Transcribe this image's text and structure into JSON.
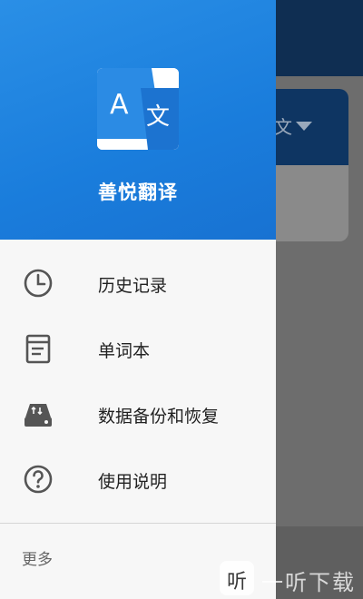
{
  "app": {
    "title": "善悦翻译",
    "logo_icon": "translate-icon",
    "header_color": "#1a7ddc"
  },
  "background": {
    "language_fragment": "文"
  },
  "menu": {
    "items": [
      {
        "label": "历史记录",
        "icon": "clock-icon"
      },
      {
        "label": "单词本",
        "icon": "notebook-icon"
      },
      {
        "label": "数据备份和恢复",
        "icon": "storage-drive-icon"
      },
      {
        "label": "使用说明",
        "icon": "help-icon"
      }
    ],
    "more_label": "更多"
  },
  "watermark": {
    "badge": "听",
    "text": "一听下载"
  }
}
